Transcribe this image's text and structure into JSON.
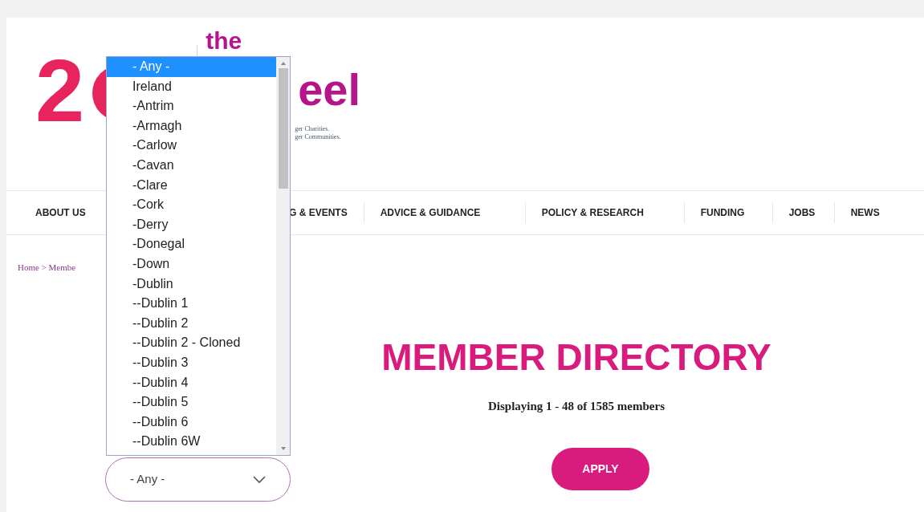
{
  "logo": {
    "numeral": "2",
    "word_top": "the",
    "word_bottom": "eel",
    "tagline": [
      "ger Charities.",
      "ger Communities."
    ]
  },
  "nav": [
    {
      "label": "ABOUT US"
    },
    {
      "label": "G & EVENTS"
    },
    {
      "label": "ADVICE & GUIDANCE"
    },
    {
      "label": "POLICY & RESEARCH"
    },
    {
      "label": "FUNDING"
    },
    {
      "label": "JOBS"
    },
    {
      "label": "NEWS"
    }
  ],
  "breadcrumb": "Home > Membe",
  "location_select": {
    "value": "- Any -",
    "options": [
      {
        "label": "- Any -",
        "selected": true
      },
      {
        "label": "Ireland",
        "selected": false
      },
      {
        "label": "-Antrim",
        "selected": false
      },
      {
        "label": "-Armagh",
        "selected": false
      },
      {
        "label": "-Carlow",
        "selected": false
      },
      {
        "label": "-Cavan",
        "selected": false
      },
      {
        "label": "-Clare",
        "selected": false
      },
      {
        "label": "-Cork",
        "selected": false
      },
      {
        "label": "-Derry",
        "selected": false
      },
      {
        "label": "-Donegal",
        "selected": false
      },
      {
        "label": "-Down",
        "selected": false
      },
      {
        "label": "-Dublin",
        "selected": false
      },
      {
        "label": "--Dublin 1",
        "selected": false
      },
      {
        "label": "--Dublin 2",
        "selected": false
      },
      {
        "label": "--Dublin 2 - Cloned",
        "selected": false
      },
      {
        "label": "--Dublin 3",
        "selected": false
      },
      {
        "label": "--Dublin 4",
        "selected": false
      },
      {
        "label": "--Dublin 5",
        "selected": false
      },
      {
        "label": "--Dublin 6",
        "selected": false
      },
      {
        "label": "--Dublin 6W",
        "selected": false
      }
    ]
  },
  "heading": "MEMBER DIRECTORY",
  "summary": "Displaying 1 - 48 of 1585 members",
  "apply_button": "APPLY"
}
